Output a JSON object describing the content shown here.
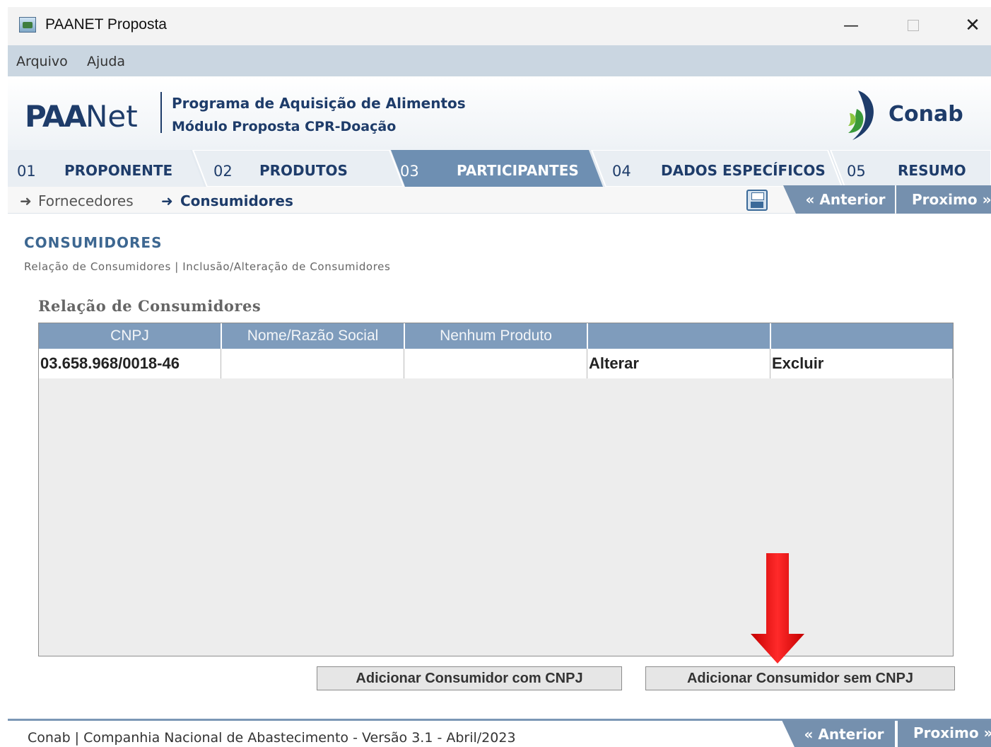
{
  "window": {
    "title": "PAANET Proposta"
  },
  "menu": {
    "items": [
      "Arquivo",
      "Ajuda"
    ]
  },
  "header": {
    "logo_paa": "PAA",
    "logo_net": "Net",
    "program_line1": "Programa de Aquisição de Alimentos",
    "program_line2": "Módulo Proposta CPR-Doação",
    "org_logo_text": "Conab"
  },
  "tabs": [
    {
      "num": "01",
      "label": "PROPONENTE",
      "active": false
    },
    {
      "num": "02",
      "label": "PRODUTOS",
      "active": false
    },
    {
      "num": "03",
      "label": "PARTICIPANTES",
      "active": true
    },
    {
      "num": "04",
      "label": "DADOS ESPECÍFICOS",
      "active": false
    },
    {
      "num": "05",
      "label": "RESUMO",
      "active": false
    }
  ],
  "subnav": {
    "items": [
      {
        "label": "Fornecedores",
        "active": false
      },
      {
        "label": "Consumidores",
        "active": true
      }
    ],
    "prev_label": "Anterior",
    "next_label": "Proximo"
  },
  "section": {
    "title": "CONSUMIDORES",
    "subtitle": "Relação de Consumidores | Inclusão/Alteração de Consumidores"
  },
  "table": {
    "title": "Relação de Consumidores",
    "columns": [
      "CNPJ",
      "Nome/Razão Social",
      "Nenhum Produto",
      "",
      ""
    ],
    "rows": [
      [
        "03.658.968/0018-46",
        "",
        "",
        "Alterar",
        "Excluir"
      ]
    ]
  },
  "buttons": {
    "add_with_cnpj": "Adicionar Consumidor com CNPJ",
    "add_without_cnpj": "Adicionar Consumidor sem CNPJ"
  },
  "footer": {
    "text": "Conab | Companhia Nacional de Abastecimento - Versão 3.1 - Abril/2023",
    "prev_label": "Anterior",
    "next_label": "Proximo"
  },
  "colors": {
    "brand_blue": "#1e3c6a",
    "tab_active": "#6e8fb2",
    "table_header": "#7f9cbc",
    "annotation_arrow": "#e60000"
  },
  "icons": [
    "app-icon",
    "minimize-icon",
    "maximize-icon",
    "close-icon",
    "conab-logo-icon",
    "arrow-right-icon",
    "save-icon",
    "double-chevron-left-icon",
    "double-chevron-right-icon",
    "red-down-arrow"
  ]
}
